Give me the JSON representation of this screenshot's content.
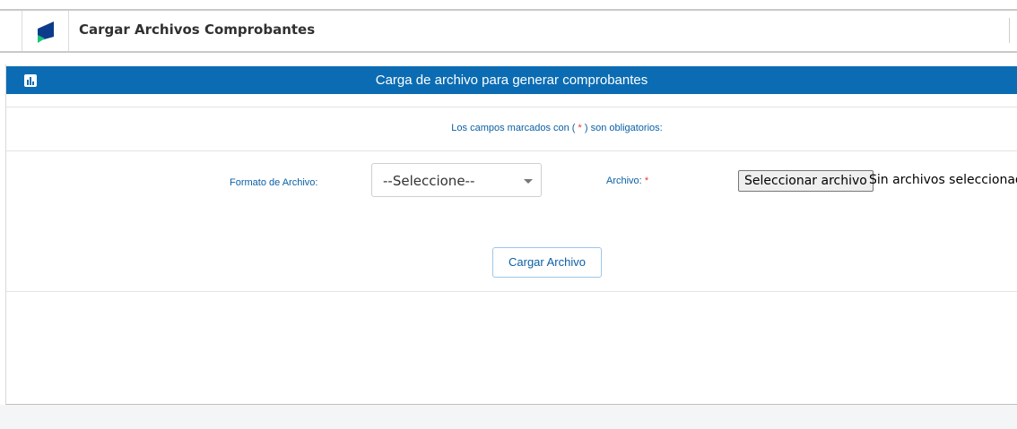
{
  "app": {
    "title": "Cargar Archivos Comprobantes"
  },
  "panel": {
    "header_title": "Carga de archivo para generar comprobantes",
    "header_color": "#0b6cb3"
  },
  "form": {
    "required_note_prefix": "Los campos marcados con (",
    "required_note_star": "*",
    "required_note_suffix": ") son obligatorios:",
    "formato_label": "Formato de Archivo:",
    "formato_selected": "--Seleccione--",
    "archivo_label": "Archivo:",
    "archivo_star": "*",
    "file_button_label": "Seleccionar archivo",
    "file_status": "Sin archivos seleccionado",
    "submit_label": "Cargar Archivo"
  },
  "icons": {
    "logo": "app-logo-icon",
    "header": "bar-chart-icon",
    "select_caret": "chevron-down-icon"
  }
}
